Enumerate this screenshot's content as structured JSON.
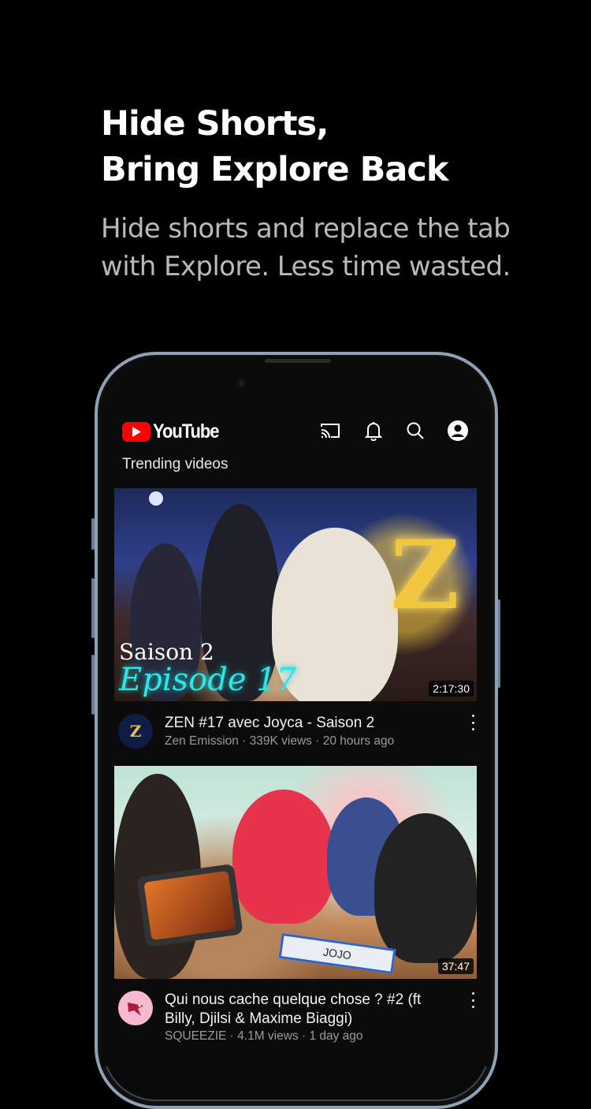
{
  "promo": {
    "headline_line1": "Hide Shorts,",
    "headline_line2": "Bring Explore Back",
    "subline_line1": "Hide shorts and replace the tab",
    "subline_line2": "with Explore.  Less time wasted."
  },
  "app": {
    "logo_text": "YouTube",
    "brand_color": "#ff0000",
    "header_icons": [
      "cast-icon",
      "bell-icon",
      "search-icon",
      "account-icon"
    ],
    "section_title": "Trending videos"
  },
  "videos": [
    {
      "title": "ZEN #17 avec Joyca - Saison 2",
      "meta": "Zen Emission · 339K views · 20 hours ago",
      "duration": "2:17:30",
      "thumb_text_1": "Saison 2",
      "thumb_text_2": "Episode 17",
      "avatar_text": "Z"
    },
    {
      "title_line1": "Qui nous cache quelque chose ? #2 (ft",
      "title_line2": "Billy, Djilsi & Maxime Biaggi)",
      "meta": "SQUEEZIE · 4.1M views · 1 day ago",
      "duration": "37:47",
      "sign_text": "JOJO"
    }
  ]
}
